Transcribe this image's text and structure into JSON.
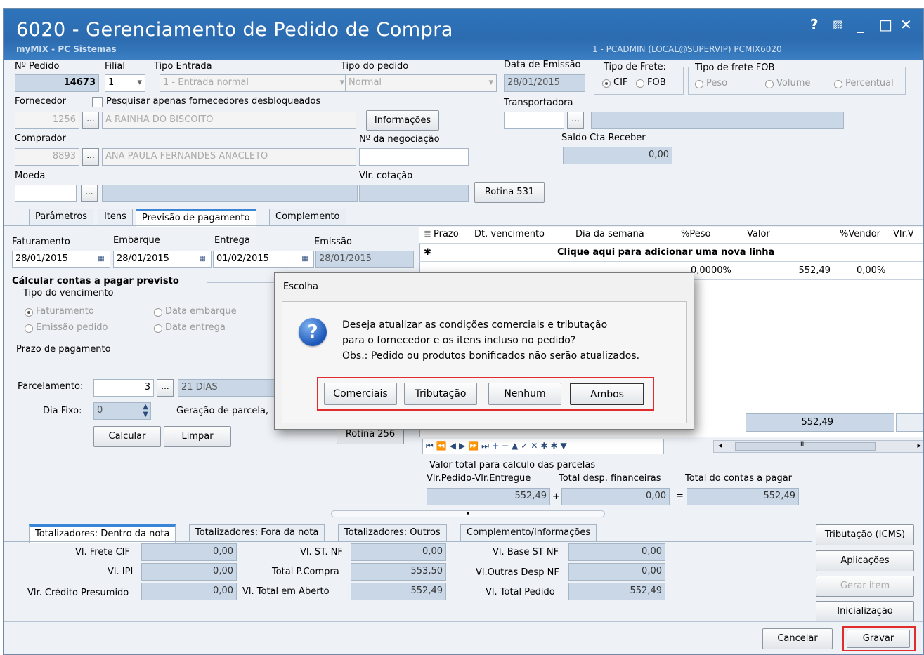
{
  "window": {
    "title": "6020 - Gerenciamento de Pedido de Compra",
    "subtitle": "myMIX - PC Sistemas",
    "user_info": "1 - PCADMIN (LOCAL@SUPERVIP)  PCMIX6020",
    "controls": {
      "help": "?",
      "minimize": "_",
      "maximize": "□",
      "close": "✕"
    }
  },
  "header": {
    "pedido_label": "Nº Pedido",
    "pedido_value": "14673",
    "filial_label": "Filial",
    "filial_value": "1",
    "tipo_entrada_label": "Tipo Entrada",
    "tipo_entrada_value": "1 - Entrada normal",
    "tipo_pedido_label": "Tipo do pedido",
    "tipo_pedido_value": "Normal",
    "data_emissao_label": "Data de Emissão",
    "data_emissao_value": "28/01/2015",
    "tipo_frete_label": "Tipo de Frete:",
    "frete_cif": "CIF",
    "frete_fob": "FOB",
    "tipo_frete_fob_label": "Tipo de frete FOB",
    "fob_peso": "Peso",
    "fob_volume": "Volume",
    "fob_percentual": "Percentual",
    "fornecedor_label": "Fornecedor",
    "pesquisar_label": "Pesquisar apenas fornecedores desbloqueados",
    "fornecedor_code": "1256",
    "fornecedor_name": "A RAINHA DO BISCOITO",
    "informacoes_button": "Informações",
    "transportadora_label": "Transportadora",
    "comprador_label": "Comprador",
    "comprador_code": "8893",
    "comprador_name": "ANA PAULA FERNANDES ANACLETO",
    "negociacao_label": "Nº da negociação",
    "saldo_label": "Saldo Cta Receber",
    "saldo_value": "0,00",
    "moeda_label": "Moeda",
    "cotacao_label": "Vlr. cotação",
    "rotina531_button": "Rotina 531",
    "dots": "..."
  },
  "tabs": {
    "parametros": "Parâmetros",
    "itens": "Itens",
    "previsao": "Previsão de pagamento",
    "complemento": "Complemento"
  },
  "previsao": {
    "faturamento_label": "Faturamento",
    "faturamento_value": "28/01/2015",
    "embarque_label": "Embarque",
    "embarque_value": "28/01/2015",
    "entrega_label": "Entrega",
    "entrega_value": "01/02/2015",
    "emissao_label": "Emissão",
    "emissao_value": "28/01/2015",
    "calcular_title": "Cálcular contas a pagar previsto",
    "tipo_venc_label": "Tipo do vencimento",
    "venc_faturamento": "Faturamento",
    "venc_embarque": "Data embarque",
    "venc_emissao": "Emissão pedido",
    "venc_entrega": "Data entrega",
    "prazo_label": "Prazo de pagamento",
    "parcelamento_label": "Parcelamento:",
    "parcelamento_value": "3",
    "parcelamento_desc": "21 DIAS",
    "dia_fixo_label": "Dia Fixo:",
    "dia_fixo_value": "0",
    "geracao_label": "Geração de parcela,",
    "calcular_button": "Calcular",
    "limpar_button": "Limpar",
    "rotina256_button": "Rotina 256"
  },
  "grid": {
    "columns": [
      "Prazo",
      "Dt. vencimento",
      "Dia da semana",
      "%Peso",
      "Valor",
      "%Vendor",
      "Vlr.V"
    ],
    "add_row_text": "Clique aqui para adicionar uma nova linha",
    "row": {
      "peso": "0,0000%",
      "valor": "552,49",
      "vendor": "0,00%"
    },
    "footer_total": "552,49",
    "scroll_mark": "III"
  },
  "totais": {
    "valor_total_label": "Valor total para calculo das parcelas",
    "pedido_entregue_label": "Vlr.Pedido-Vlr.Entregue",
    "pedido_entregue_value": "552,49",
    "desp_fin_label": "Total desp. financeiras",
    "desp_fin_value": "0,00",
    "contas_pagar_label": "Total do contas a pagar",
    "contas_pagar_value": "552,49",
    "plus": "+",
    "equals": "="
  },
  "bottom_tabs": {
    "dentro": "Totalizadores: Dentro da nota",
    "fora": "Totalizadores: Fora da nota",
    "outros": "Totalizadores: Outros",
    "complemento": "Complemento/Informações"
  },
  "totalizadores": {
    "frete_cif_label": "Vl. Frete CIF",
    "frete_cif_value": "0,00",
    "ipi_label": "Vl. IPI",
    "ipi_value": "0,00",
    "credito_label": "Vlr. Crédito Presumido",
    "credito_value": "0,00",
    "st_nf_label": "Vl. ST. NF",
    "st_nf_value": "0,00",
    "total_compra_label": "Total P.Compra",
    "total_compra_value": "553,50",
    "total_aberto_label": "Vl. Total em Aberto",
    "total_aberto_value": "552,49",
    "base_st_label": "Vl. Base ST NF",
    "base_st_value": "0,00",
    "outras_desp_label": "Vl.Outras Desp NF",
    "outras_desp_value": "0,00",
    "total_pedido_label": "Vl. Total  Pedido",
    "total_pedido_value": "552,49"
  },
  "side_buttons": {
    "tributacao": "Tributação (ICMS)",
    "aplicacoes": "Aplicações",
    "gerar_item": "Gerar item",
    "inicializacao": "Inicialização"
  },
  "footer_buttons": {
    "cancelar": "Cancelar",
    "gravar": "Gravar"
  },
  "dialog": {
    "title": "Escolha",
    "line1": "Deseja atualizar as condições comerciais e tributação",
    "line2": "para o fornecedor e os itens incluso no pedido?",
    "line3": "Obs.: Pedido ou produtos bonificados não serão atualizados.",
    "buttons": {
      "comerciais": "Comerciais",
      "tributacao": "Tributação",
      "nenhum": "Nenhum",
      "ambos": "Ambos"
    }
  }
}
